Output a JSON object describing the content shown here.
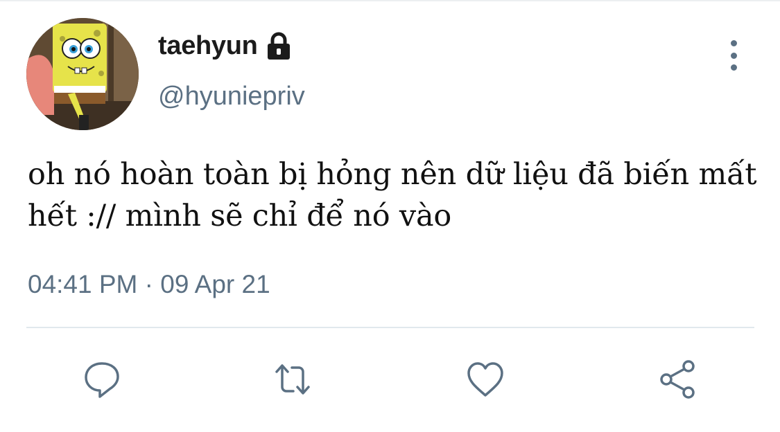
{
  "tweet": {
    "display_name": "taehyun",
    "handle": "@hyuniepriv",
    "text": "oh nó hoàn toàn bị hỏng nên dữ liệu đã biến mất hết :// mình sẽ chỉ để nó vào",
    "timestamp": "04:41 PM · 09 Apr 21",
    "protected": true
  },
  "icons": {
    "avatar": "spongebob-avatar",
    "lock": "lock-icon",
    "more": "more-vertical-icon",
    "reply": "reply-icon",
    "retweet": "retweet-icon",
    "like": "heart-icon",
    "share": "share-icon"
  },
  "colors": {
    "secondary_text": "#5b7083",
    "icon": "#5b7083",
    "divider": "#e1e8ed"
  }
}
